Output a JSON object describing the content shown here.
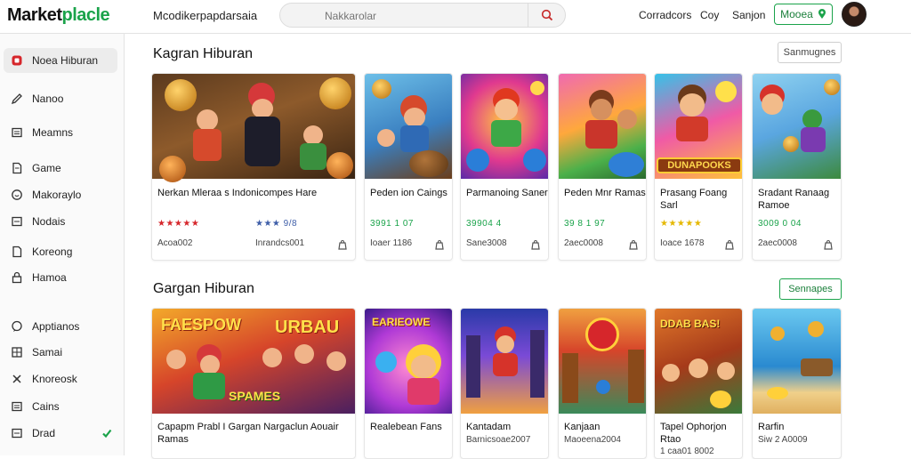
{
  "header": {
    "logo_main": "Market",
    "logo_accent": "placle",
    "app_title": "Mcodikerpapdarsaia",
    "search_placeholder": "Nakkarolar",
    "nav": [
      "Corradcors",
      "Coy",
      "Sanjon"
    ],
    "cta_label": "Mooea"
  },
  "sidebar": {
    "items": [
      {
        "label": "Noea Hiburan",
        "icon": "game-icon",
        "active": true
      },
      {
        "label": "Nanoo",
        "icon": "pen-icon"
      },
      {
        "label": "Meamns",
        "icon": "box-icon"
      },
      {
        "label": "Game",
        "icon": "document-icon"
      },
      {
        "label": "Makoraylo",
        "icon": "shield-icon"
      },
      {
        "label": "Nodais",
        "icon": "box-icon"
      },
      {
        "label": "Koreong",
        "icon": "document-icon"
      },
      {
        "label": "Hamoa",
        "icon": "lock-icon"
      },
      {
        "label": "Apptianos",
        "icon": "chat-icon"
      },
      {
        "label": "Samai",
        "icon": "grid-icon"
      },
      {
        "label": "Knoreosk",
        "icon": "cross-icon"
      },
      {
        "label": "Cains",
        "icon": "box-icon"
      },
      {
        "label": "Drad",
        "icon": "box-icon",
        "check": true
      }
    ]
  },
  "sections": [
    {
      "title": "Kagran Hiburan",
      "see_all": "Sanmugnes"
    },
    {
      "title": "Gargan Hiburan",
      "see_all": "Sennapes"
    }
  ],
  "row1": [
    {
      "title": "Nerkan Mleraa s Indonicompes Hare",
      "rating": "★★★★★",
      "rating_color": "#d6262b",
      "rating_extra": "★★★ 9/8",
      "rating_extra_color": "#3e5ea8",
      "meta": "Acoa002",
      "meta2": "Inrandcs001"
    },
    {
      "title": "Peden ion Caings",
      "rating": "3991 1 07",
      "rating_color": "#1aa34a",
      "meta": "Ioaer 1186"
    },
    {
      "title": "Parmanoing Saner",
      "rating": "39904 4",
      "rating_color": "#1aa34a",
      "meta": "Sane3008"
    },
    {
      "title": "Peden Mnr Ramas",
      "rating": "39 8 1 97",
      "rating_color": "#1aa34a",
      "meta": "2aec0008"
    },
    {
      "title": "Prasang Foang Sarl",
      "rating": "★★★★★",
      "rating_color": "#e5b800",
      "meta": "Ioace 1678"
    },
    {
      "title": "Sradant Ranaag Ramoe",
      "rating": "3009 0 04",
      "rating_color": "#1aa34a",
      "meta": "2aec0008"
    }
  ],
  "row2": [
    {
      "title": "Capapm Prabl I Gargan Nargaclun Aouair Ramas"
    },
    {
      "title": "Realebean Fans"
    },
    {
      "title": "Kantadam",
      "sub": "Barnicsoae2007"
    },
    {
      "title": "Kanjaan",
      "sub": "Maoeena2004"
    },
    {
      "title": "Tapel Ophorjon Rtao",
      "sub": "1 caa01 8002"
    },
    {
      "title": "Rarfin",
      "sub": "Siw 2 A0009"
    }
  ],
  "banner_text": {
    "card1_top": "FAESPOW",
    "card1_right": "URBAU",
    "card1_bottom": "SPAMES",
    "card2_top": "EARIEOWE",
    "card5_top": "DDAB BAS!",
    "row1_card5_banner": "DUNAPOOKS"
  },
  "colors": {
    "accent": "#1aa34a",
    "red": "#d6262b",
    "star_gold": "#e5b800"
  }
}
